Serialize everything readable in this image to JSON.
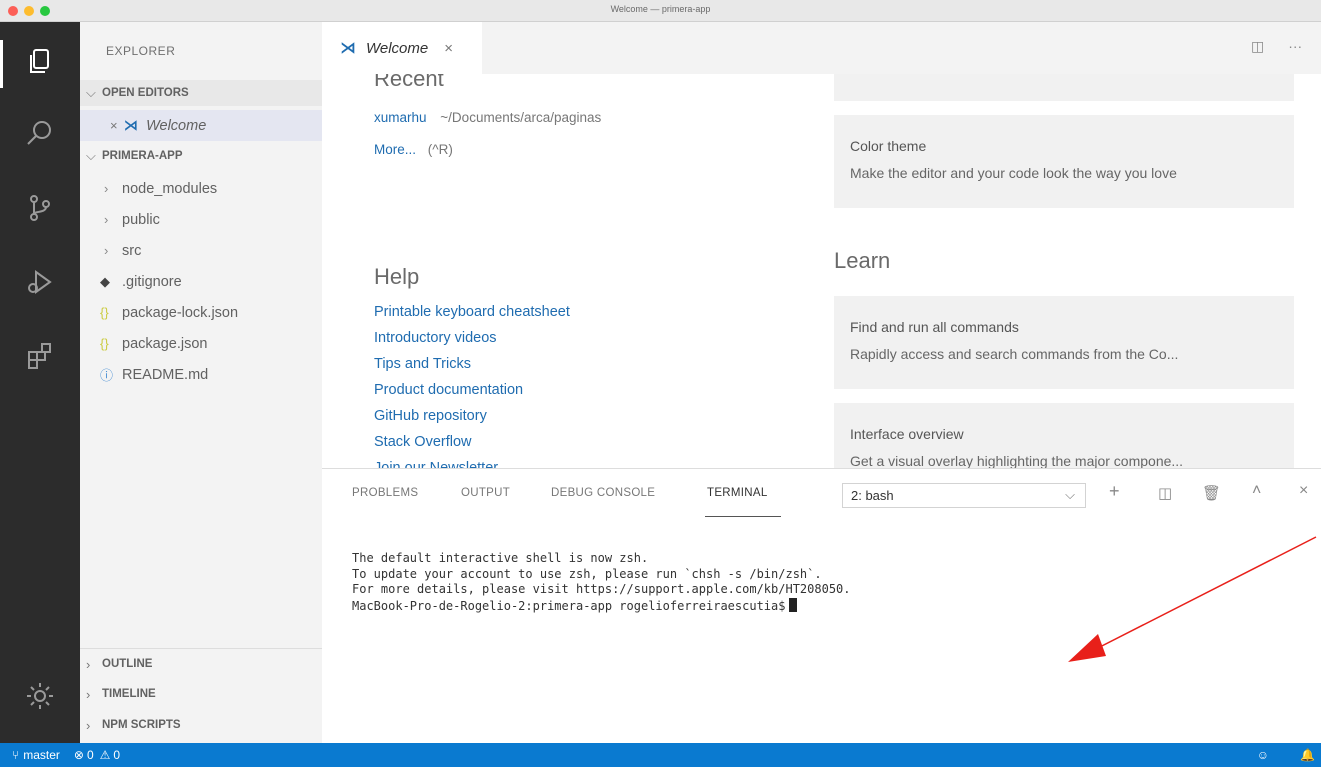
{
  "window": {
    "title": "Welcome — primera-app"
  },
  "sidebar": {
    "header": "EXPLORER",
    "open_editors_label": "OPEN EDITORS",
    "open_editor_item": "Welcome",
    "project_label": "PRIMERA-APP",
    "items": [
      {
        "label": "node_modules",
        "type": "folder"
      },
      {
        "label": "public",
        "type": "folder"
      },
      {
        "label": "src",
        "type": "folder"
      },
      {
        "label": ".gitignore",
        "type": "file"
      },
      {
        "label": "package-lock.json",
        "type": "json"
      },
      {
        "label": "package.json",
        "type": "json"
      },
      {
        "label": "README.md",
        "type": "info"
      }
    ],
    "bottom_sections": [
      "OUTLINE",
      "TIMELINE",
      "NPM SCRIPTS"
    ]
  },
  "tabs": [
    {
      "label": "Welcome"
    }
  ],
  "welcome": {
    "recent_heading": "Recent",
    "recent_item_name": "xumarhu",
    "recent_item_path": "~/Documents/arca/paginas",
    "more_label": "More...",
    "more_shortcut": "(^R)",
    "help_heading": "Help",
    "help_links": [
      "Printable keyboard cheatsheet",
      "Introductory videos",
      "Tips and Tricks",
      "Product documentation",
      "GitHub repository",
      "Stack Overflow",
      "Join our Newsletter"
    ],
    "color_theme_title": "Color theme",
    "color_theme_desc": "Make the editor and your code look the way you love",
    "learn_heading": "Learn",
    "learn_cards": [
      {
        "title": "Find and run all commands",
        "desc": "Rapidly access and search commands from the Co..."
      },
      {
        "title": "Interface overview",
        "desc": "Get a visual overlay highlighting the major compone..."
      }
    ]
  },
  "panel": {
    "tabs": [
      "PROBLEMS",
      "OUTPUT",
      "DEBUG CONSOLE",
      "TERMINAL"
    ],
    "active_tab": "TERMINAL",
    "terminal_select": "2: bash",
    "terminal_lines": [
      "The default interactive shell is now zsh.",
      "To update your account to use zsh, please run `chsh -s /bin/zsh`.",
      "For more details, please visit https://support.apple.com/kb/HT208050.",
      "MacBook-Pro-de-Rogelio-2:primera-app rogelioferreiraescutia$"
    ]
  },
  "status": {
    "branch": "master",
    "errors": "0",
    "warnings": "0"
  },
  "colors": {
    "status_bar": "#0a7ad0",
    "activity_bar": "#2c2c2c",
    "link": "#1f6cb0",
    "annotation_arrow": "#e8201a"
  }
}
